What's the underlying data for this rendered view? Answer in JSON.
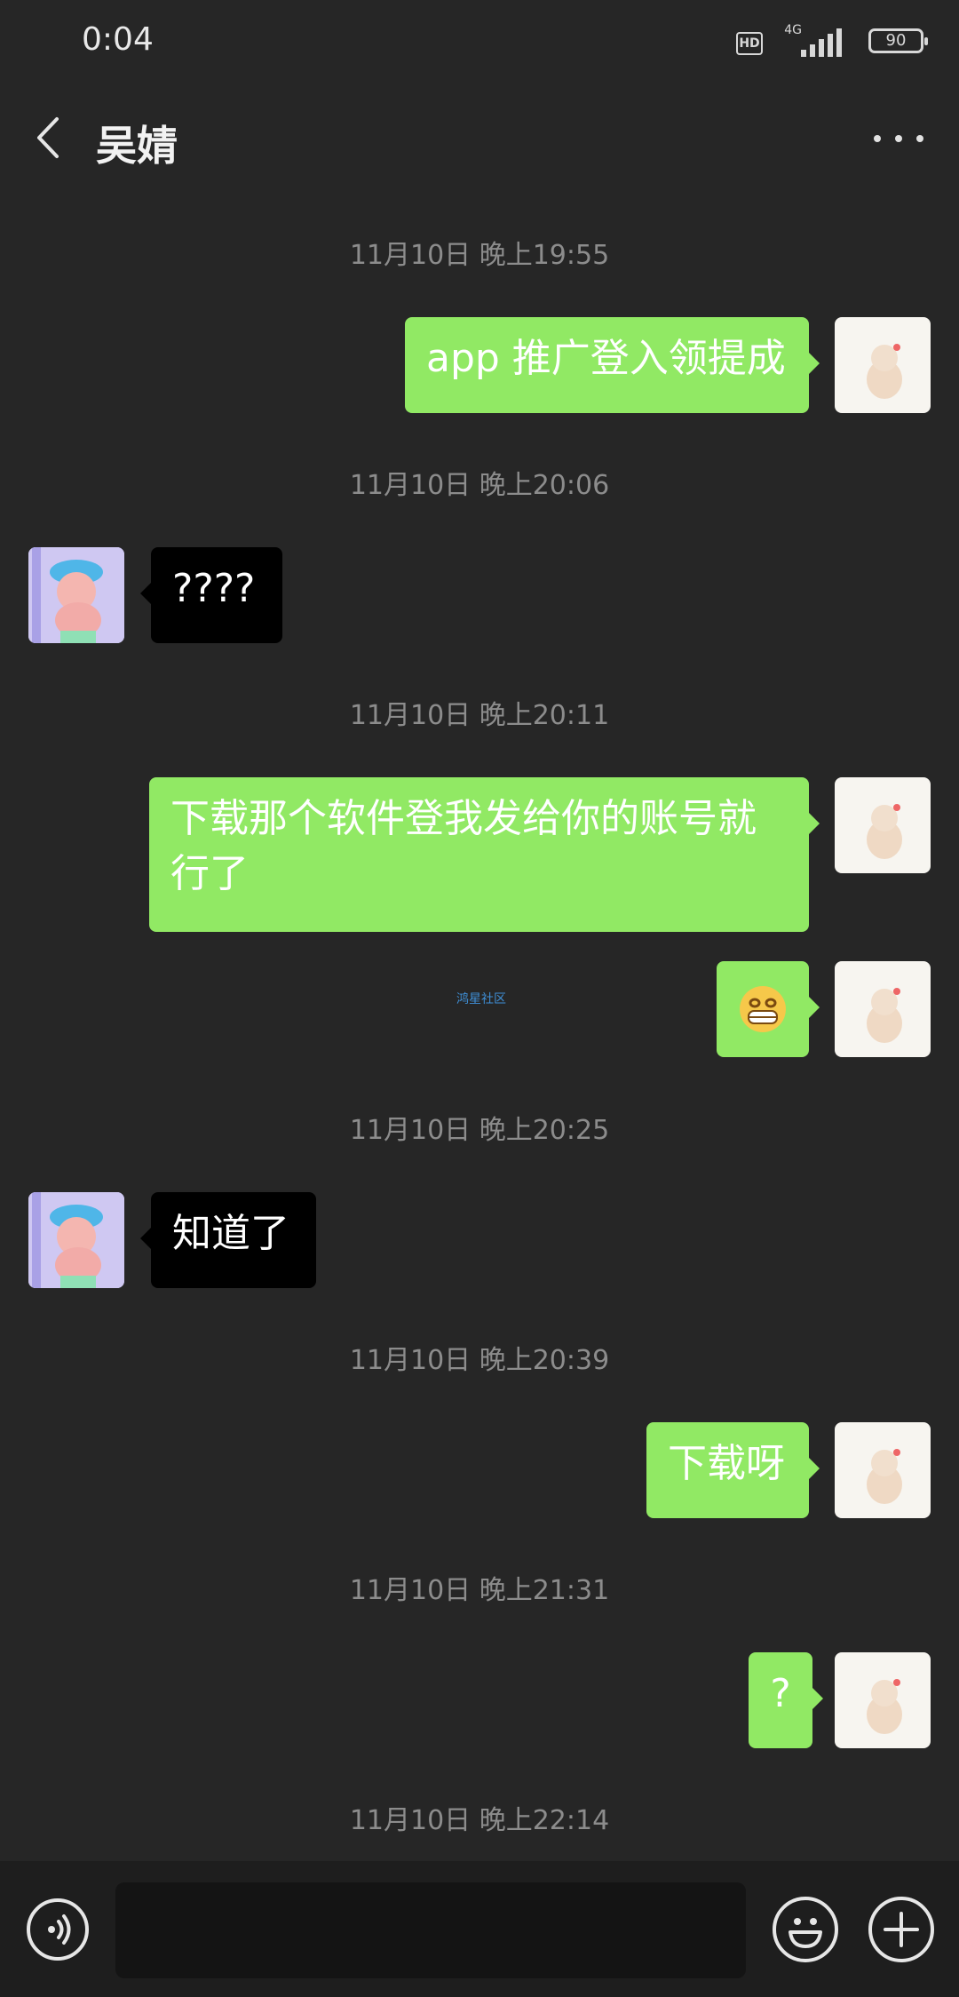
{
  "status_bar": {
    "time": "0:04",
    "network": "4G",
    "hd": "HD",
    "battery": "90"
  },
  "header": {
    "title": "吴婧"
  },
  "messages": [
    {
      "timestamp": "11月10日 晚上19:55",
      "sender": "me",
      "text": "app 推广登入领提成"
    },
    {
      "timestamp": "11月10日 晚上20:06",
      "sender": "them",
      "text": "????"
    },
    {
      "timestamp": "11月10日 晚上20:11",
      "sender": "me",
      "text": "下载那个软件登我发给你的账号就行了"
    },
    {
      "sender": "me",
      "type": "emoji",
      "icon": "grinning-face-icon"
    },
    {
      "timestamp": "11月10日 晚上20:25",
      "sender": "them",
      "text": "知道了"
    },
    {
      "timestamp": "11月10日 晚上20:39",
      "sender": "me",
      "text": "下载呀"
    },
    {
      "timestamp": "11月10日 晚上21:31",
      "sender": "me",
      "text": "?"
    },
    {
      "timestamp": "11月10日 晚上22:14"
    }
  ],
  "watermark": "鸿星社区",
  "input": {
    "value": ""
  },
  "colors": {
    "background": "#262626",
    "my_bubble": "#91e964",
    "their_bubble": "#000000",
    "timestamp": "#8c8c8c"
  }
}
